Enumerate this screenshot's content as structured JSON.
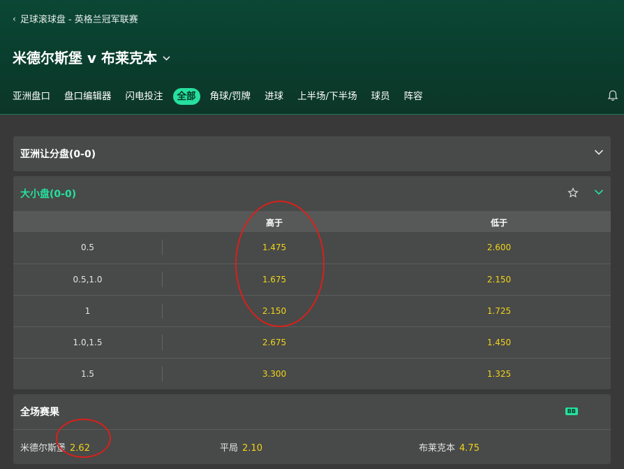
{
  "breadcrumb": "足球滚球盘 - 英格兰冠军联赛",
  "match": {
    "title": "米德尔斯堡 v 布莱克本"
  },
  "tabs": [
    "亚洲盘口",
    "盘口编辑器",
    "闪电投注",
    "全部",
    "角球/罚牌",
    "进球",
    "上半场/下半场",
    "球员",
    "阵容"
  ],
  "active_tab": "全部",
  "asian_handicap": {
    "title": "亚洲让分盘(0-0)"
  },
  "over_under": {
    "title": "大小盘(0-0)",
    "col_over": "高于",
    "col_under": "低于",
    "rows": [
      {
        "line": "0.5",
        "over": "1.475",
        "under": "2.600"
      },
      {
        "line": "0.5,1.0",
        "over": "1.675",
        "under": "2.150"
      },
      {
        "line": "1",
        "over": "2.150",
        "under": "1.725"
      },
      {
        "line": "1.0,1.5",
        "over": "2.675",
        "under": "1.450"
      },
      {
        "line": "1.5",
        "over": "3.300",
        "under": "1.325"
      }
    ]
  },
  "full_time": {
    "title": "全场赛果",
    "badge": "BB",
    "home": {
      "name": "米德尔斯堡",
      "odd": "2.62"
    },
    "draw": {
      "name": "平局",
      "odd": "2.10"
    },
    "away": {
      "name": "布莱克本",
      "odd": "4.75"
    }
  },
  "colors": {
    "accent": "#26e0a0",
    "odds": "#f4d21c",
    "annotation": "#d9201b"
  },
  "icons": [
    "chevron-left-icon",
    "chevron-down-icon",
    "bell-icon",
    "star-icon"
  ]
}
